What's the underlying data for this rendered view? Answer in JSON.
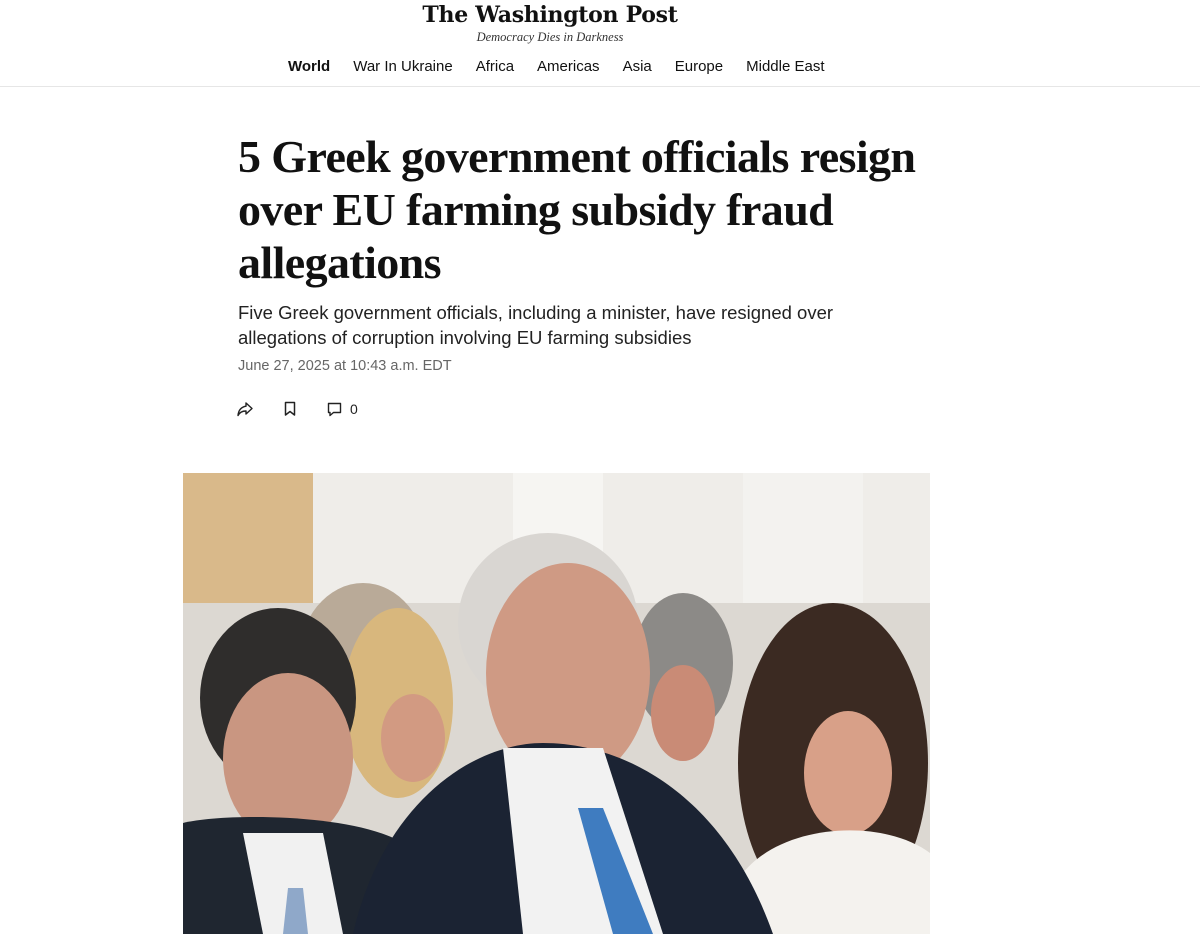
{
  "masthead": {
    "logo_text": "The Washington Post",
    "tagline": "Democracy Dies in Darkness"
  },
  "nav": {
    "items": [
      {
        "label": "World",
        "active": true
      },
      {
        "label": "War In Ukraine"
      },
      {
        "label": "Africa"
      },
      {
        "label": "Americas"
      },
      {
        "label": "Asia"
      },
      {
        "label": "Europe"
      },
      {
        "label": "Middle East"
      }
    ]
  },
  "article": {
    "headline": "5 Greek government officials resign over EU farming subsidy fraud allegations",
    "subheadline": "Five Greek government officials, including a minister, have resigned over allegations of corruption involving EU farming subsidies",
    "dateline": "June 27, 2025 at 10:43 a.m. EDT",
    "actions": {
      "share_icon": "share-icon",
      "save_icon": "bookmark-icon",
      "comment_icon": "comment-icon",
      "comment_count": "0"
    }
  },
  "photo": {
    "description_icon": "lead-photo"
  },
  "colors": {
    "text": "#111111",
    "muted": "#666666",
    "divider": "#e6e6e6"
  }
}
